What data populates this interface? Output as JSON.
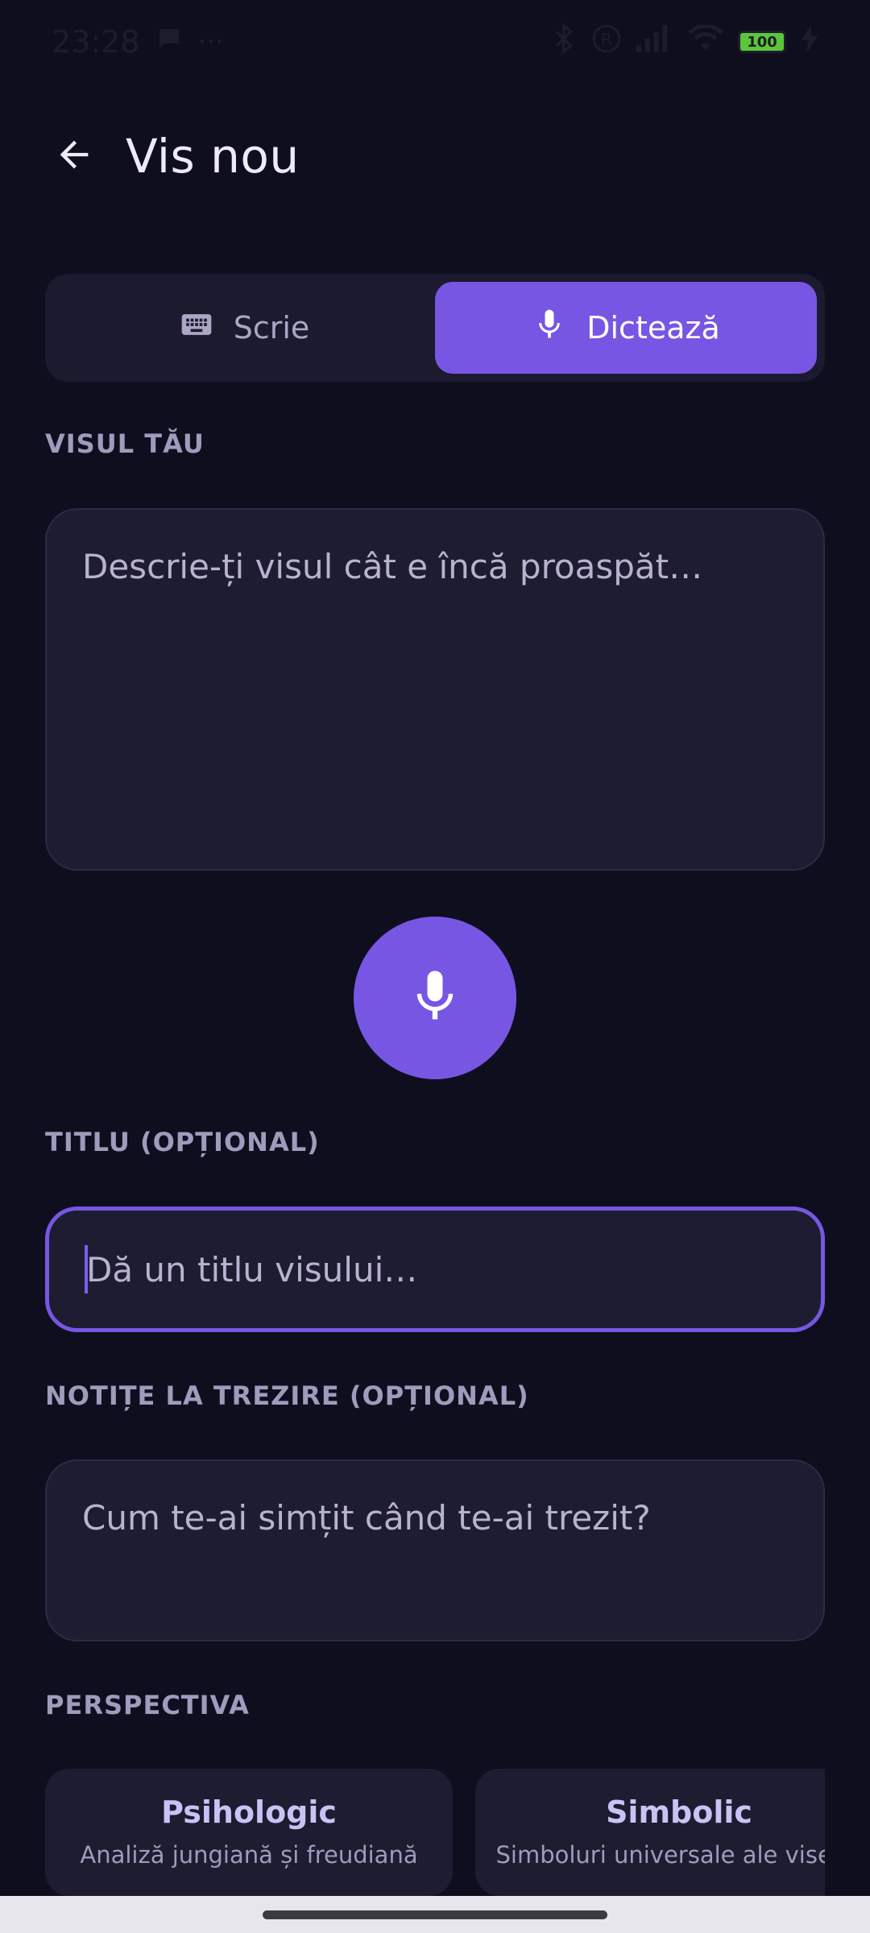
{
  "status_bar": {
    "time": "23:28",
    "battery": "100"
  },
  "header": {
    "title": "Vis nou"
  },
  "mode_toggle": {
    "write_label": "Scrie",
    "dictate_label": "Dictează",
    "active": "dictate"
  },
  "dream": {
    "section_label": "VISUL TĂU",
    "placeholder": "Descrie-ți visul cât e încă proaspăt…"
  },
  "title_field": {
    "section_label": "TITLU (OPȚIONAL)",
    "placeholder": "Dă un titlu visului…"
  },
  "notes": {
    "section_label": "NOTIȚE LA TREZIRE (OPȚIONAL)",
    "placeholder": "Cum te-ai simțit când te-ai trezit?"
  },
  "perspective": {
    "section_label": "PERSPECTIVA",
    "cards": [
      {
        "title": "Psihologic",
        "subtitle": "Analiză jungiană și freudiană"
      },
      {
        "title": "Simbolic",
        "subtitle": "Simboluri universale ale viselor"
      }
    ]
  },
  "colors": {
    "background": "#0f0e1f",
    "accent": "#7856e4",
    "surface": "#1d1c31",
    "label": "#9f9bbc"
  }
}
